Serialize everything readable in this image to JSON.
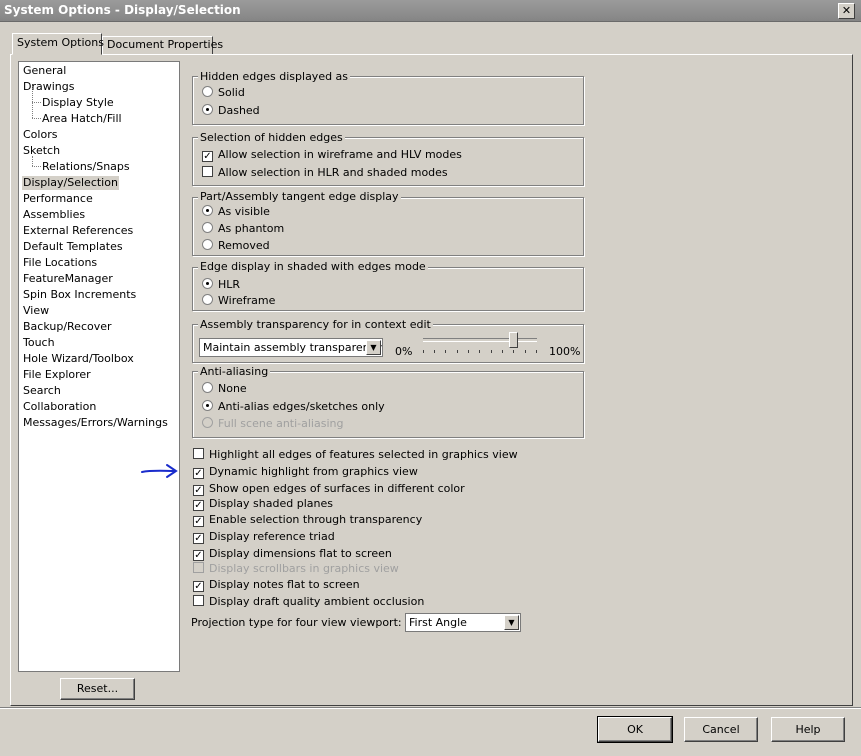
{
  "window": {
    "title": "System Options - Display/Selection",
    "close_glyph": "✕"
  },
  "tabs": [
    {
      "label": "System Options"
    },
    {
      "label": "Document Properties"
    }
  ],
  "tree": {
    "items": [
      {
        "label": "General"
      },
      {
        "label": "Drawings"
      },
      {
        "label": "Display Style"
      },
      {
        "label": "Area Hatch/Fill"
      },
      {
        "label": "Colors"
      },
      {
        "label": "Sketch"
      },
      {
        "label": "Relations/Snaps"
      },
      {
        "label": "Display/Selection"
      },
      {
        "label": "Performance"
      },
      {
        "label": "Assemblies"
      },
      {
        "label": "External References"
      },
      {
        "label": "Default Templates"
      },
      {
        "label": "File Locations"
      },
      {
        "label": "FeatureManager"
      },
      {
        "label": "Spin Box Increments"
      },
      {
        "label": "View"
      },
      {
        "label": "Backup/Recover"
      },
      {
        "label": "Touch"
      },
      {
        "label": "Hole Wizard/Toolbox"
      },
      {
        "label": "File Explorer"
      },
      {
        "label": "Search"
      },
      {
        "label": "Collaboration"
      },
      {
        "label": "Messages/Errors/Warnings"
      }
    ],
    "selected": "Display/Selection"
  },
  "groups": {
    "hidden_edges": {
      "title": "Hidden edges displayed as",
      "options": [
        "Solid",
        "Dashed"
      ],
      "selected": "Dashed"
    },
    "selection_hidden": {
      "title": "Selection of hidden edges",
      "options": [
        "Allow selection in wireframe and HLV modes",
        "Allow selection in HLR and shaded modes"
      ],
      "checked": [
        true,
        false
      ]
    },
    "tangent": {
      "title": "Part/Assembly tangent edge display",
      "options": [
        "As visible",
        "As phantom",
        "Removed"
      ],
      "selected": "As visible"
    },
    "shaded_edges": {
      "title": "Edge display in shaded with edges mode",
      "options": [
        "HLR",
        "Wireframe"
      ],
      "selected": "HLR"
    },
    "transparency": {
      "title": "Assembly transparency for in context edit",
      "combo_value": "Maintain assembly transparency",
      "min_label": "0%",
      "max_label": "100%",
      "slider_percent": 82
    },
    "antialias": {
      "title": "Anti-aliasing",
      "options": [
        "None",
        "Anti-alias edges/sketches only",
        "Full scene anti-aliasing"
      ],
      "selected": "Anti-alias edges/sketches only",
      "disabled": [
        false,
        false,
        true
      ]
    }
  },
  "checks": [
    {
      "label": "Highlight all edges of features selected in graphics view",
      "checked": false,
      "disabled": false
    },
    {
      "label": "Dynamic highlight from graphics view",
      "checked": true,
      "disabled": false
    },
    {
      "label": "Show open edges of surfaces in different color",
      "checked": true,
      "disabled": false
    },
    {
      "label": "Display shaded planes",
      "checked": true,
      "disabled": false
    },
    {
      "label": "Enable selection through transparency",
      "checked": true,
      "disabled": false
    },
    {
      "label": "Display reference triad",
      "checked": true,
      "disabled": false
    },
    {
      "label": "Display dimensions flat to screen",
      "checked": true,
      "disabled": false
    },
    {
      "label": "Display scrollbars in graphics view",
      "checked": false,
      "disabled": true
    },
    {
      "label": "Display notes flat to screen",
      "checked": true,
      "disabled": false
    },
    {
      "label": "Display draft quality ambient occlusion",
      "checked": false,
      "disabled": false
    }
  ],
  "projection": {
    "label": "Projection type for four view viewport:",
    "value": "First Angle"
  },
  "buttons": {
    "reset": "Reset...",
    "ok": "OK",
    "cancel": "Cancel",
    "help": "Help"
  },
  "glyphs": {
    "check_mark": "✓",
    "combo_arrow": "▼"
  },
  "colors": {
    "annotation_arrow": "#1a2ccc",
    "dialog_bg": "#d4d0c8"
  }
}
